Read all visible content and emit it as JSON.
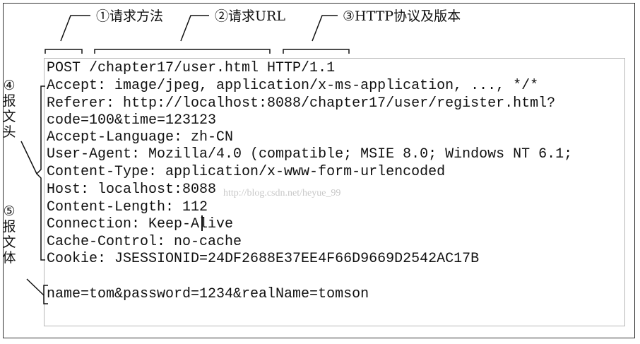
{
  "callouts": {
    "method": "①请求方法",
    "url": "②请求URL",
    "protocol": "③HTTP协议及版本"
  },
  "request_lines": [
    "POST /chapter17/user.html HTTP/1.1",
    "Accept: image/jpeg, application/x-ms-application, ..., */*",
    "Referer: http://localhost:8088/chapter17/user/register.html?",
    "code=100&time=123123",
    "Accept-Language: zh-CN",
    "User-Agent: Mozilla/4.0 (compatible; MSIE 8.0; Windows NT 6.1;",
    "Content-Type: application/x-www-form-urlencoded",
    "Host: localhost:8088",
    "Content-Length: 112",
    "Connection: Keep-Alive",
    "Cache-Control: no-cache",
    "Cookie: JSESSIONID=24DF2688E37EE4F66D9669D2542AC17B",
    "",
    "name=tom&password=1234&realName=tomson"
  ],
  "side_labels": {
    "headers": [
      "④",
      "报",
      "文",
      "头"
    ],
    "body": [
      "⑤",
      "报",
      "文",
      "体"
    ]
  },
  "watermark": "http://blog.csdn.net/heyue_99"
}
